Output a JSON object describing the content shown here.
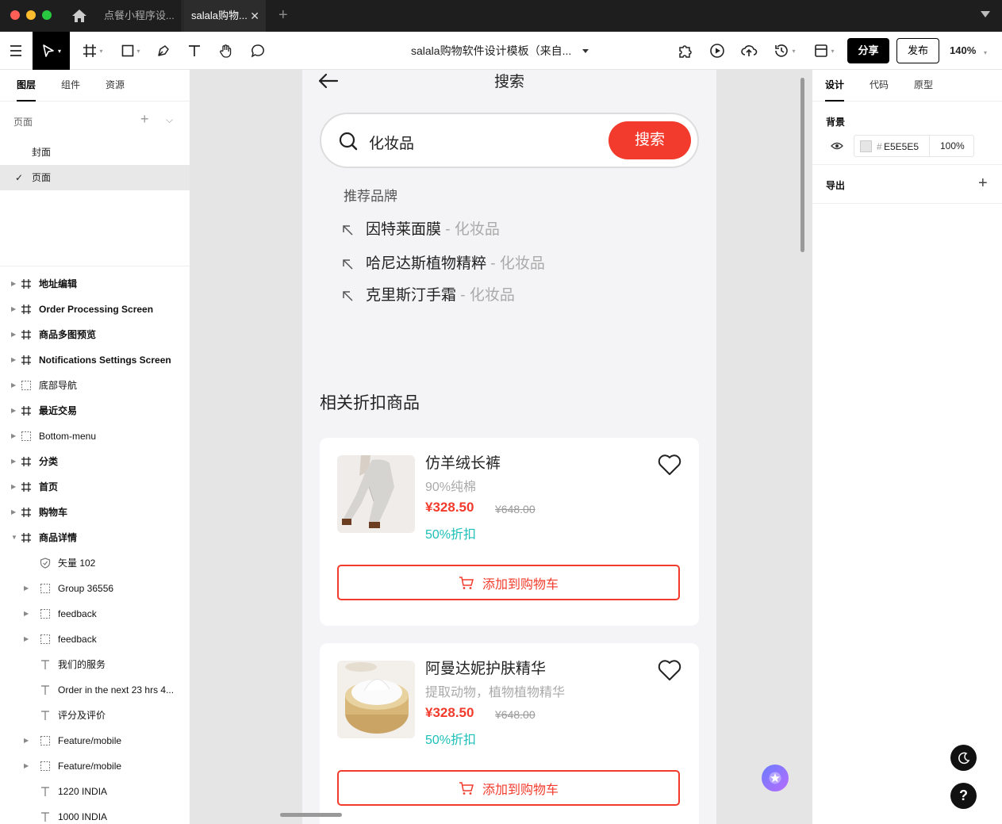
{
  "titlebar": {
    "tabs": [
      {
        "label": "点餐小程序设..."
      },
      {
        "label": "salala购物..."
      }
    ],
    "close_glyph": "✕",
    "add_glyph": "+"
  },
  "toolbar": {
    "doc_title": "salala购物软件设计模板（来自...",
    "share_label": "分享",
    "publish_label": "发布",
    "zoom": "140%"
  },
  "left_panel": {
    "tabs": [
      "图层",
      "组件",
      "资源"
    ],
    "pages_label": "页面",
    "pages": [
      {
        "label": "封面",
        "selected": false
      },
      {
        "label": "页面",
        "selected": true
      }
    ],
    "layers": [
      {
        "label": "地址编辑",
        "type": "frame",
        "bold": true
      },
      {
        "label": "Order Processing Screen",
        "type": "frame",
        "bold": true
      },
      {
        "label": "商品多图预览",
        "type": "frame",
        "bold": true
      },
      {
        "label": "Notifications Settings Screen",
        "type": "frame",
        "bold": true
      },
      {
        "label": "底部导航",
        "type": "component",
        "bold": false
      },
      {
        "label": "最近交易",
        "type": "frame",
        "bold": true
      },
      {
        "label": "Bottom-menu",
        "type": "component",
        "bold": false
      },
      {
        "label": "分类",
        "type": "frame",
        "bold": true
      },
      {
        "label": "首页",
        "type": "frame",
        "bold": true
      },
      {
        "label": "购物车",
        "type": "frame",
        "bold": true
      },
      {
        "label": "商品详情",
        "type": "frame",
        "bold": true,
        "expanded": true
      },
      {
        "label": "矢量 102",
        "type": "vector",
        "child": true
      },
      {
        "label": "Group 36556",
        "type": "group",
        "child": true
      },
      {
        "label": "feedback",
        "type": "group",
        "child": true
      },
      {
        "label": "feedback",
        "type": "group",
        "child": true
      },
      {
        "label": "我们的服务",
        "type": "text",
        "child": true
      },
      {
        "label": "Order in the next 23 hrs 4...",
        "type": "text",
        "child": true
      },
      {
        "label": "评分及评价",
        "type": "text",
        "child": true
      },
      {
        "label": "Feature/mobile",
        "type": "group",
        "child": true
      },
      {
        "label": "Feature/mobile",
        "type": "group",
        "child": true
      },
      {
        "label": "1220 INDIA",
        "type": "text",
        "child": true
      },
      {
        "label": "1000 INDIA",
        "type": "text",
        "child": true
      }
    ]
  },
  "mobile": {
    "title": "搜索",
    "search": {
      "value": "化妆品",
      "button_label": "搜索"
    },
    "recommend_title": "推荐品牌",
    "recommendations": [
      {
        "name": "因特莱面膜",
        "category": " - 化妆品"
      },
      {
        "name": "哈尼达斯植物精粹",
        "category": " - 化妆品"
      },
      {
        "name": "克里斯汀手霜",
        "category": " - 化妆品"
      }
    ],
    "section_title": "相关折扣商品",
    "products": [
      {
        "name": "仿羊绒长裤",
        "desc": "90%纯棉",
        "price": "¥328.50",
        "old_price": "¥648.00",
        "discount": "50%折扣",
        "cart_label": "添加到购物车"
      },
      {
        "name": "阿曼达妮护肤精华",
        "desc": "提取动物，植物植物精华",
        "price": "¥328.50",
        "old_price": "¥648.00",
        "discount": "50%折扣",
        "cart_label": "添加到购物车"
      }
    ]
  },
  "right_panel": {
    "tabs": [
      "设计",
      "代码",
      "原型"
    ],
    "background_label": "背景",
    "background_hash": "#",
    "background_hex": "E5E5E5",
    "background_opacity": "100%",
    "export_label": "导出",
    "help_glyph": "?"
  },
  "colors": {
    "accent_red": "#f23b2c",
    "discount_teal": "#1cc0b8",
    "canvas_bg": "#E5E5E5"
  }
}
